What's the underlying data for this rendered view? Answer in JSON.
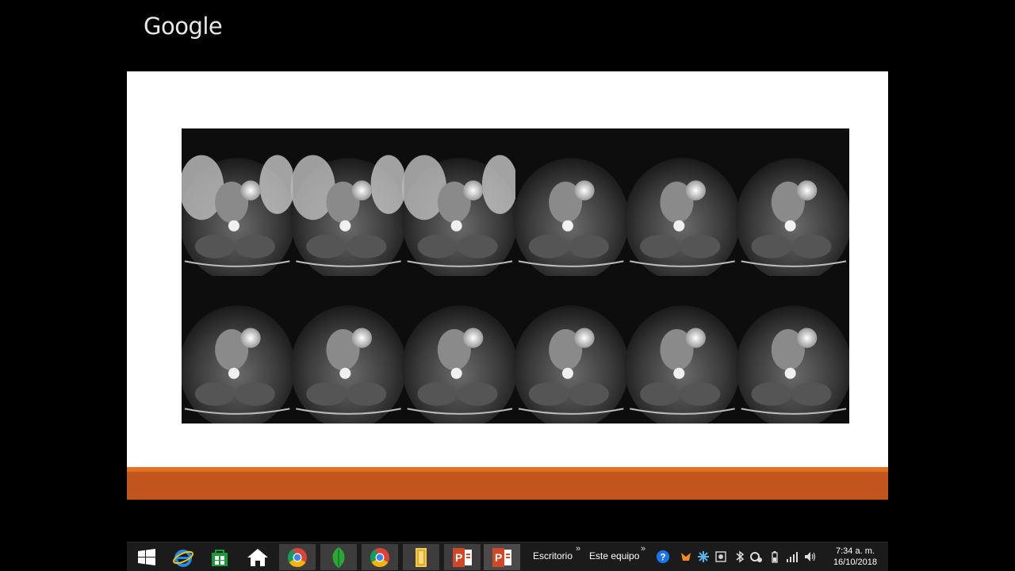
{
  "logo": {
    "text": "Google"
  },
  "slide": {
    "image_name": "axial-mri-spine-series",
    "accent_colors": {
      "top": "#e7701f",
      "bottom": "#c0561d"
    }
  },
  "taskbar": {
    "pinned": [
      {
        "name": "start-button",
        "icon": "windows-logo-icon"
      },
      {
        "name": "taskbar-internet-explorer",
        "icon": "internet-explorer-icon"
      },
      {
        "name": "taskbar-store",
        "icon": "store-icon"
      },
      {
        "name": "taskbar-home",
        "icon": "home-icon"
      },
      {
        "name": "taskbar-chrome-1",
        "icon": "chrome-icon"
      },
      {
        "name": "taskbar-green-app",
        "icon": "leaf-icon"
      },
      {
        "name": "taskbar-chrome-2",
        "icon": "chrome-icon"
      },
      {
        "name": "taskbar-file-explorer",
        "icon": "folder-icon"
      },
      {
        "name": "taskbar-powerpoint-1",
        "icon": "powerpoint-icon"
      },
      {
        "name": "taskbar-powerpoint-2",
        "icon": "powerpoint-icon"
      }
    ],
    "toolbar_escritorio": "Escritorio",
    "toolbar_equipo": "Este equipo",
    "chevron": "»",
    "clock_time": "7:34 a. m.",
    "clock_date": "16/10/2018"
  }
}
